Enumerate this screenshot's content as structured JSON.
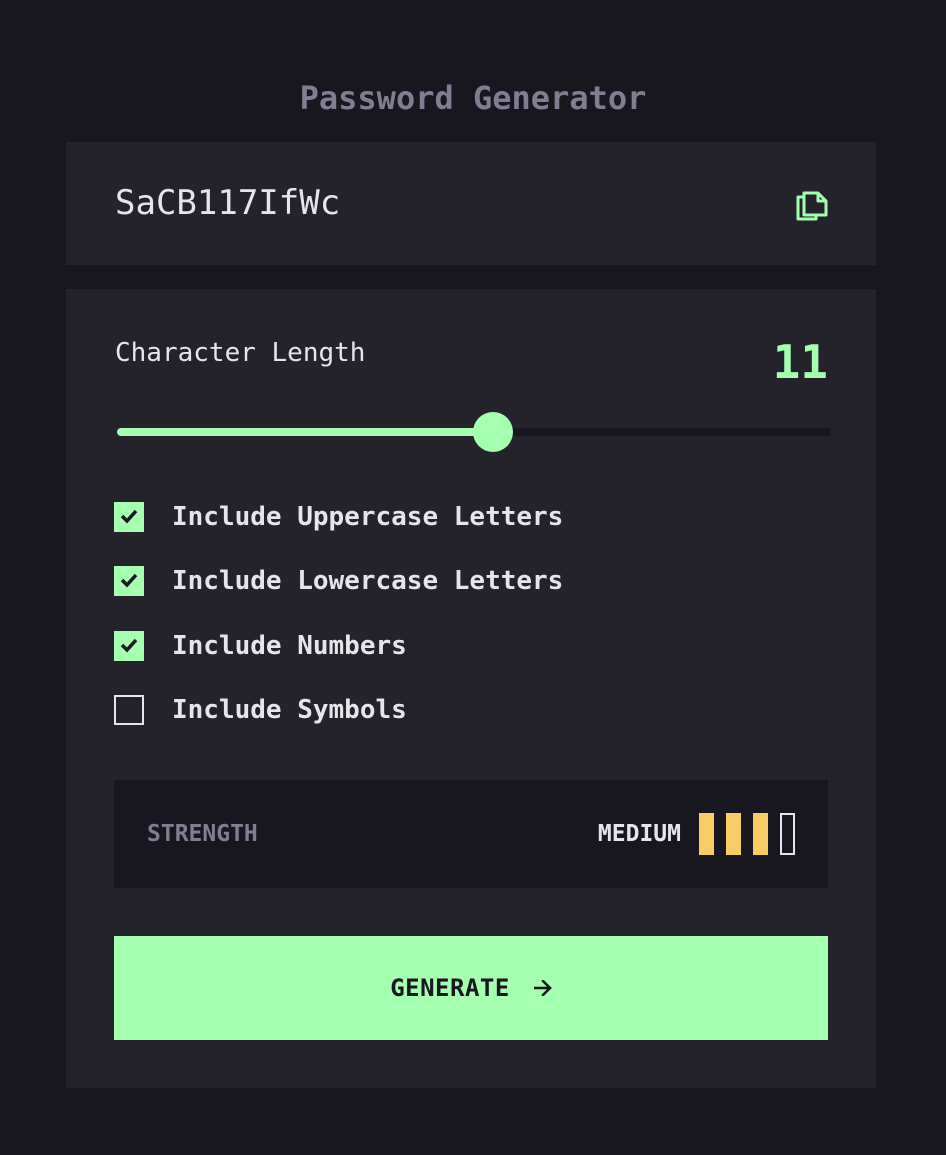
{
  "app": {
    "title": "Password Generator"
  },
  "output": {
    "password": "SaCB117IfWc",
    "copy_icon": "copy-icon"
  },
  "length": {
    "label": "Character Length",
    "value": "11",
    "min": 0,
    "max": 20,
    "current": 11
  },
  "options": [
    {
      "label": "Include Uppercase Letters",
      "checked": true
    },
    {
      "label": "Include Lowercase Letters",
      "checked": true
    },
    {
      "label": "Include Numbers",
      "checked": true
    },
    {
      "label": "Include Symbols",
      "checked": false
    }
  ],
  "strength": {
    "label": "STRENGTH",
    "value": "MEDIUM",
    "level": 3,
    "max_level": 4,
    "bar_color": "#f8cd65"
  },
  "generate": {
    "label": "GENERATE",
    "icon": "arrow-right-icon"
  },
  "colors": {
    "background": "#18171f",
    "panel": "#24232c",
    "accent": "#a4ffaf",
    "text": "#e6e5ea",
    "muted": "#817d92"
  }
}
